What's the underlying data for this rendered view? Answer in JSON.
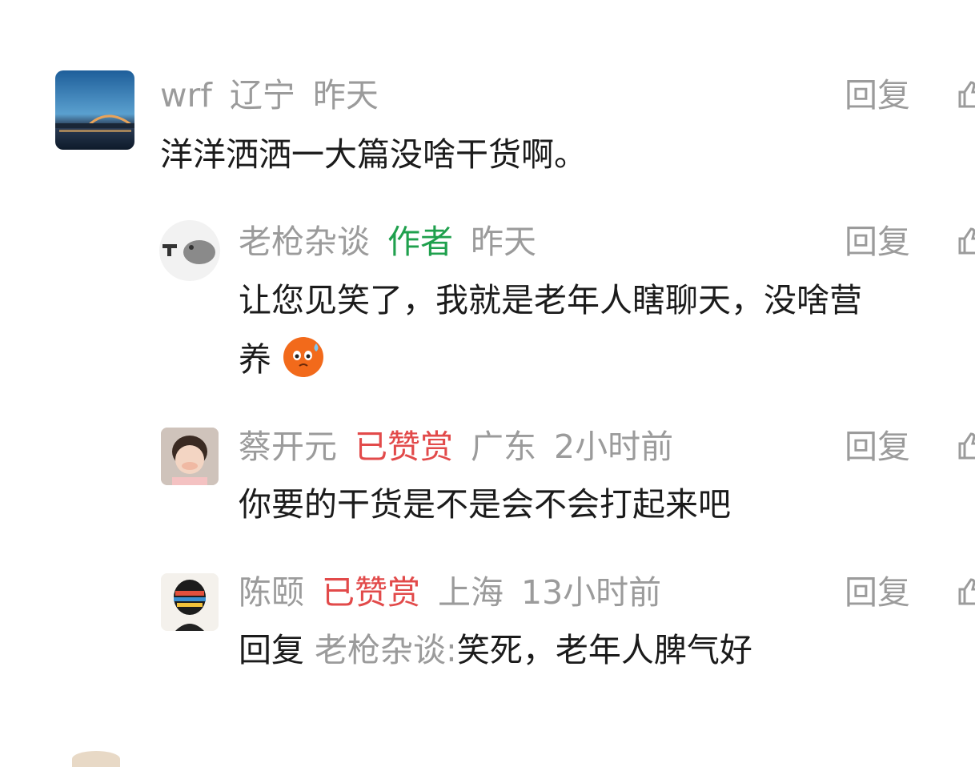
{
  "reply_label": "回复",
  "comments": [
    {
      "username": "wrf",
      "location": "辽宁",
      "time": "昨天",
      "text": "洋洋洒洒一大篇没啥干货啊。"
    },
    {
      "username": "老枪杂谈",
      "tag": "作者",
      "time": "昨天",
      "text_line1": "让您见笑了，我就是老年人瞎聊天，没啥营",
      "text_line2": "养"
    },
    {
      "username": "蔡开元",
      "tag": "已赞赏",
      "location": "广东",
      "time": "2小时前",
      "text": "你要的干货是不是会不会打起来吧"
    },
    {
      "username": "陈颐",
      "tag": "已赞赏",
      "location": "上海",
      "time": "13小时前",
      "reply_prefix": "回复",
      "mention": "老枪杂谈:",
      "text": "笑死，老年人脾气好"
    }
  ],
  "colors": {
    "meta": "#9b9b9b",
    "author_tag": "#1fa04d",
    "tipped_tag": "#e24a4a",
    "text": "#1b1b1b"
  }
}
